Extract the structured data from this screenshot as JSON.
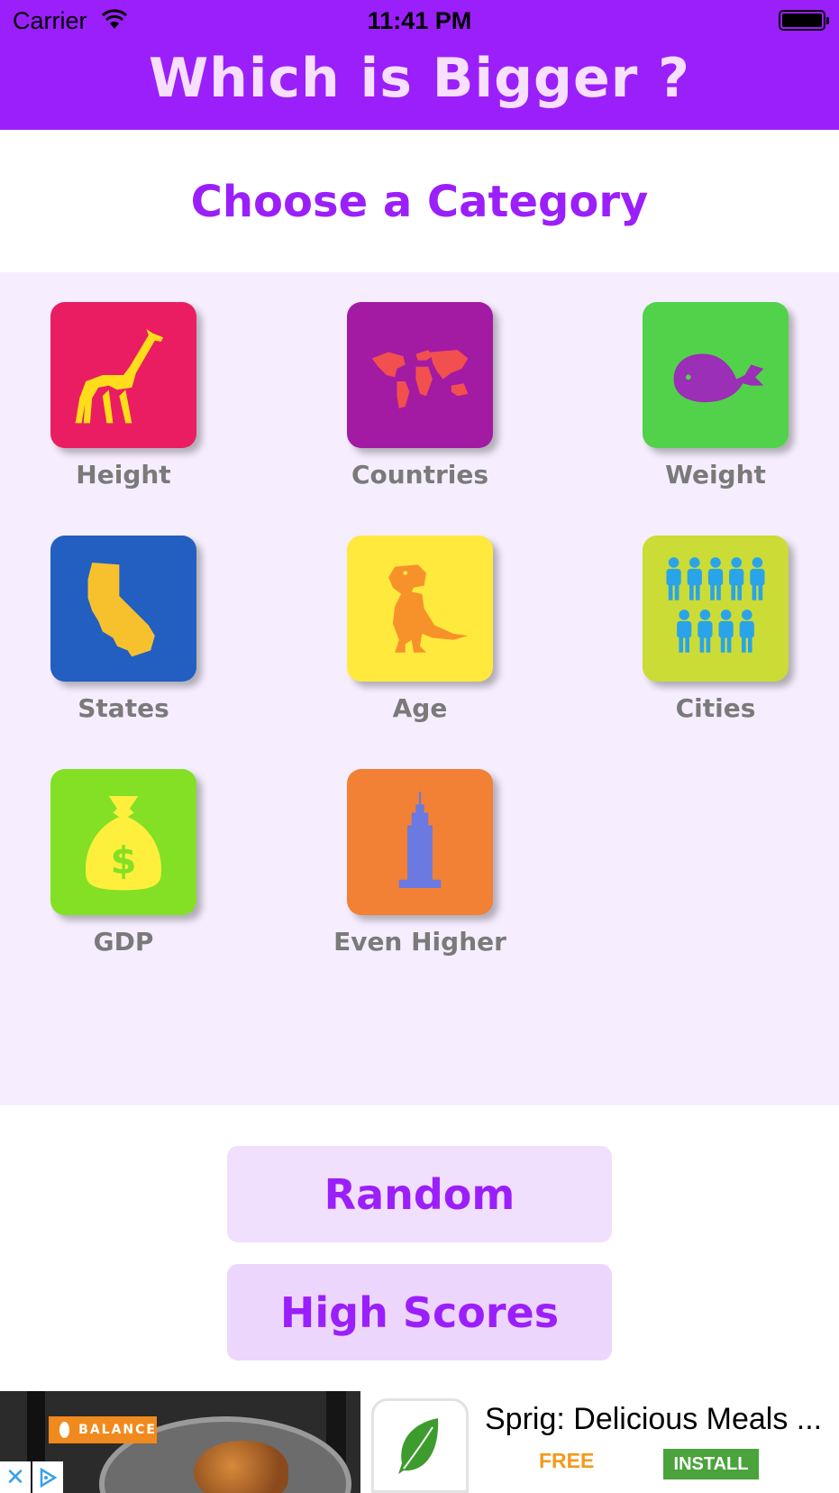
{
  "status_bar": {
    "carrier": "Carrier",
    "time": "11:41 PM"
  },
  "header": {
    "title": "Which is Bigger ?",
    "color": "#9b1ffa"
  },
  "subtitle": "Choose a Category",
  "categories": [
    {
      "label": "Height",
      "icon": "giraffe-icon",
      "bg": "#ea1d62"
    },
    {
      "label": "Countries",
      "icon": "world-map-icon",
      "bg": "#a31aa3"
    },
    {
      "label": "Weight",
      "icon": "whale-icon",
      "bg": "#52d24a"
    },
    {
      "label": "States",
      "icon": "california-icon",
      "bg": "#225fc0"
    },
    {
      "label": "Age",
      "icon": "dinosaur-icon",
      "bg": "#ffe93d"
    },
    {
      "label": "Cities",
      "icon": "people-icon",
      "bg": "#cbdc36"
    },
    {
      "label": "GDP",
      "icon": "money-bag-icon",
      "bg": "#83e025"
    },
    {
      "label": "Even Higher",
      "icon": "skyscraper-icon",
      "bg": "#f28035"
    }
  ],
  "buttons": {
    "random": "Random",
    "high_scores": "High Scores"
  },
  "ad": {
    "brand_tag": "BALANCE",
    "app_name": "Sprig: Delicious Meals ...",
    "price": "FREE",
    "install": "INSTALL",
    "close": "✕"
  }
}
